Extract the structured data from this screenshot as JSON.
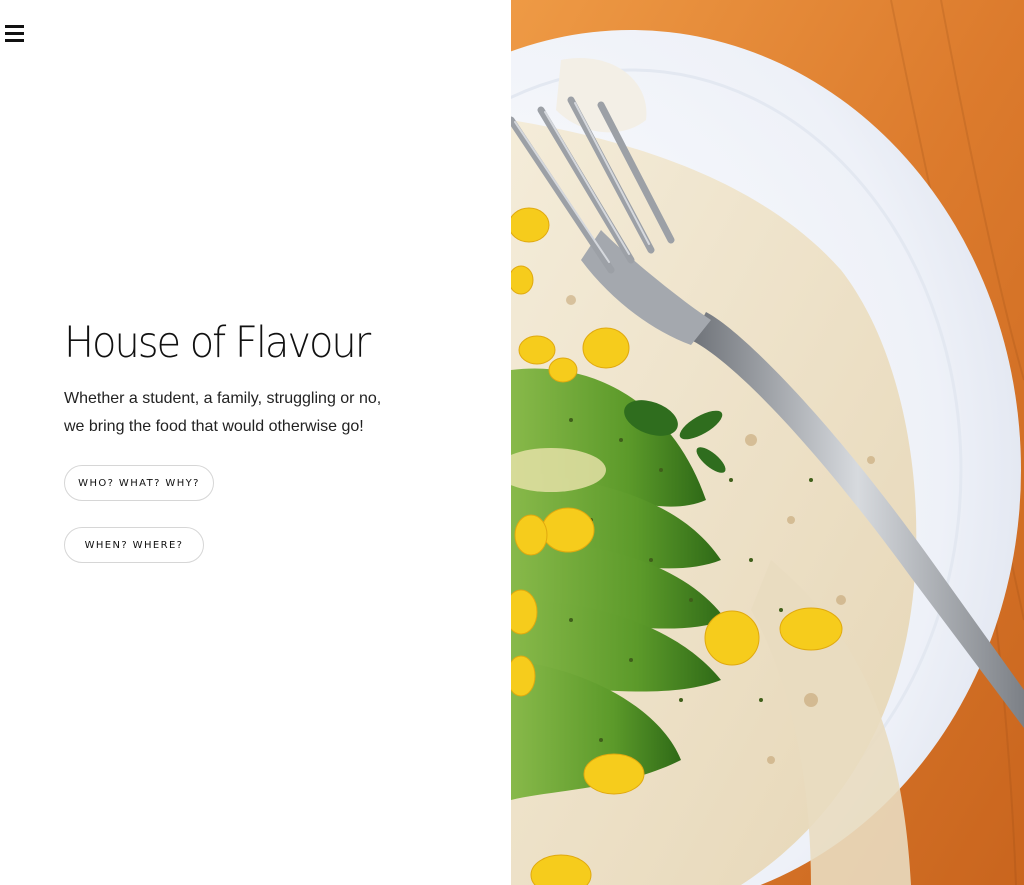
{
  "header": {
    "menu_icon": "hamburger-menu-icon"
  },
  "hero": {
    "title": "House of Flavour",
    "subtitle_line1": "Whether a student, a family, struggling or no,",
    "subtitle_line2": "we bring the food that would otherwise go!"
  },
  "buttons": {
    "who_label": "WHO? WHAT? WHY?",
    "when_label": "WHEN? WHERE?"
  },
  "hero_image": {
    "subject": "flatbread with avocado slices, sweet corn and herbs on a white plate with a fork, on a wooden table",
    "colors": {
      "wood": "#d9782c",
      "plate": "#f4f6fb",
      "flatbread": "#efe6d2",
      "avocado": "#5f9a2c",
      "corn": "#f7cf1f",
      "fork": "#a9adb3"
    }
  }
}
